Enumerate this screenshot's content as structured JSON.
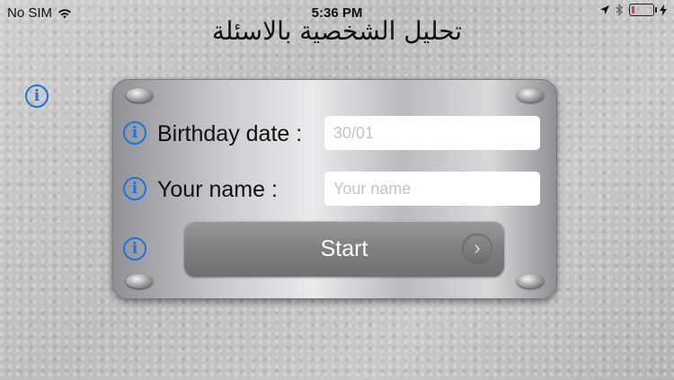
{
  "status_bar": {
    "carrier": "No SIM",
    "time": "5:36 PM",
    "battery_level": 0.12,
    "battery_color": "#e53935"
  },
  "title": "تحليل الشخصية بالاسئلة",
  "form": {
    "birthday_label": "Birthday date :",
    "birthday_placeholder": "30/01",
    "name_label": "Your name :",
    "name_placeholder": "Your name",
    "start_label": "Start"
  },
  "icons": {
    "info": "info-circle-icon",
    "chevron": "chevron-right-icon"
  },
  "accent_color": "#1a73e8"
}
